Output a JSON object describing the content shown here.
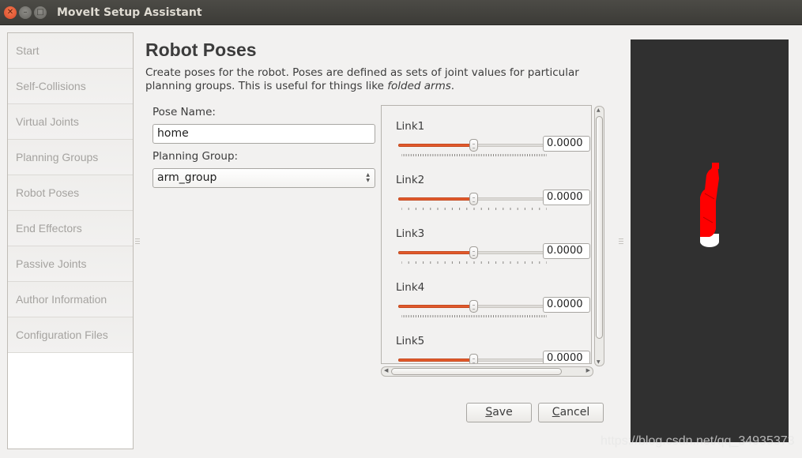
{
  "window": {
    "title": "MoveIt Setup Assistant",
    "controls": [
      "close",
      "minimize",
      "maximize"
    ]
  },
  "sidebar": {
    "items": [
      {
        "label": "Start"
      },
      {
        "label": "Self-Collisions"
      },
      {
        "label": "Virtual Joints"
      },
      {
        "label": "Planning Groups"
      },
      {
        "label": "Robot Poses"
      },
      {
        "label": "End Effectors"
      },
      {
        "label": "Passive Joints"
      },
      {
        "label": "Author Information"
      },
      {
        "label": "Configuration Files"
      }
    ]
  },
  "page": {
    "title": "Robot Poses",
    "description_main": "Create poses for the robot. Poses are defined as sets of joint values for particular planning groups. This is useful for things like ",
    "description_em": "folded arms",
    "description_end": "."
  },
  "form": {
    "pose_name_label": "Pose Name:",
    "pose_name_value": "home",
    "planning_group_label": "Planning Group:",
    "planning_group_value": "arm_group"
  },
  "joints": [
    {
      "name": "Link1",
      "value": "0.0000",
      "slider_fraction": 0.5,
      "dense_ticks": true
    },
    {
      "name": "Link2",
      "value": "0.0000",
      "slider_fraction": 0.5,
      "dense_ticks": false
    },
    {
      "name": "Link3",
      "value": "0.0000",
      "slider_fraction": 0.5,
      "dense_ticks": false
    },
    {
      "name": "Link4",
      "value": "0.0000",
      "slider_fraction": 0.5,
      "dense_ticks": true
    },
    {
      "name": "Link5",
      "value": "0.0000",
      "slider_fraction": 0.5,
      "dense_ticks": false
    }
  ],
  "buttons": {
    "save_mnemonic": "S",
    "save_rest": "ave",
    "cancel_mnemonic": "C",
    "cancel_rest": "ancel"
  },
  "viewport": {
    "background": "#303030",
    "robot_color": "#ff0000",
    "base_color": "#ffffff"
  },
  "watermark": "https://blog.csdn.net/qq_34935373"
}
